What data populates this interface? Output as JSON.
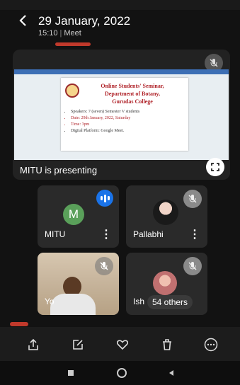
{
  "header": {
    "title": "29 January, 2022",
    "time": "15:10",
    "separator": "|",
    "meeting_type": "Meet"
  },
  "presentation": {
    "slide": {
      "heading_line1": "Online Students' Seminar,",
      "heading_line2": "Department of Botany,",
      "heading_line3": "Gurudas College",
      "bullets": [
        "Speakers: 7 (seven) Semester V students",
        "Date: 29th January, 2022, Saturday",
        "Time: 3pm",
        "Digital Platform: Google Meet."
      ]
    },
    "caption": "MITU is presenting"
  },
  "participants": [
    {
      "name": "MITU",
      "initial": "M"
    },
    {
      "name": "Pallabhi"
    },
    {
      "name": "Yo"
    },
    {
      "name": "Ish",
      "others": "54 others"
    }
  ],
  "toolbar": {
    "icons": [
      "share-icon",
      "edit-icon",
      "heart-icon",
      "delete-icon",
      "more-icon"
    ]
  },
  "colors": {
    "accent_blue": "#1a73e8",
    "avatar_green": "#5aa05a",
    "slide_red": "#b0242a"
  }
}
